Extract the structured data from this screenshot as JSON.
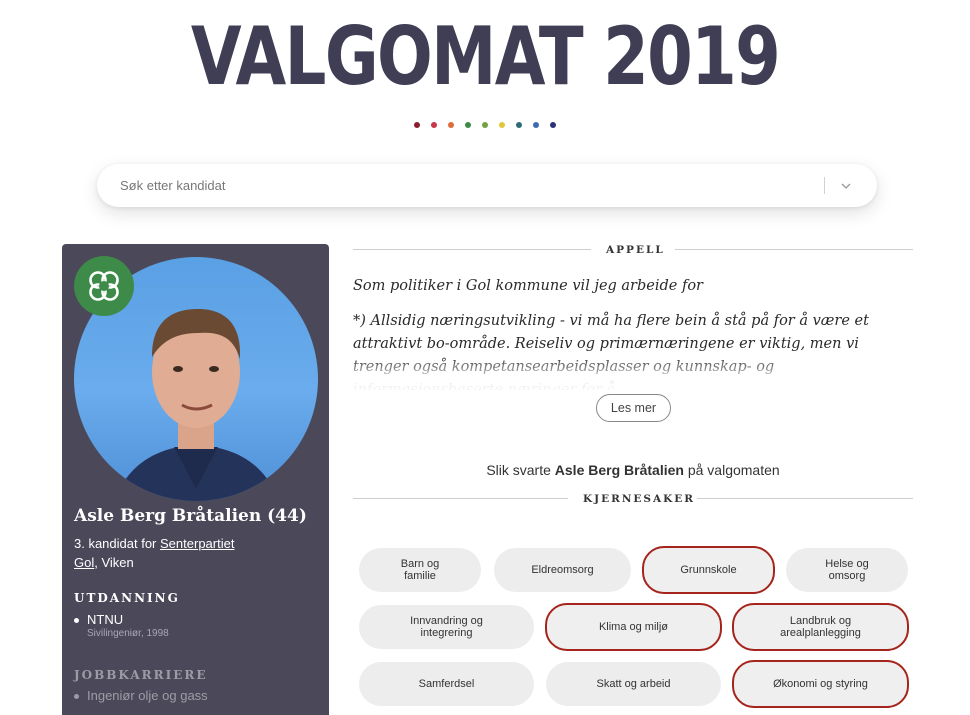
{
  "header": {
    "title": "VALGOMAT 2019",
    "dot_colors": [
      "#8b1e2e",
      "#c8374a",
      "#e06a3c",
      "#3d8a49",
      "#6fa33f",
      "#e2c73a",
      "#2e6b78",
      "#3b6bb4",
      "#2b3275"
    ]
  },
  "search": {
    "placeholder": "Søk etter kandidat",
    "value": ""
  },
  "candidate": {
    "name": "Asle Berg Bråtalien (44)",
    "rank_text": "3. kandidat for",
    "party": "Senterpartiet",
    "municipality": "Gol",
    "county": ", Viken",
    "party_logo": "clover-icon",
    "education_heading": "UTDANNING",
    "education": [
      {
        "school": "NTNU",
        "detail": "Sivilingeniør, 1998"
      }
    ],
    "career_heading": "JOBBKARRIERE",
    "career": [
      "Ingeniør olje og gass"
    ]
  },
  "appeal": {
    "heading": "APPELL",
    "para1": "Som politiker i Gol kommune vil jeg arbeide for",
    "para2": "*) Allsidig næringsutvikling - vi må ha flere bein å stå på for å være et attraktivt bo-område. Reiseliv og primærnæringene er viktig, men vi trenger også kompetansearbeidsplasser og kunnskap- og informasjonsbaserte næringer for å",
    "read_more": "Les mer"
  },
  "answered": {
    "prefix": "Slik svarte",
    "name": "Asle Berg Bråtalien",
    "suffix": "på valgomaten"
  },
  "core_issues": {
    "heading": "KJERNESAKER",
    "topics": [
      {
        "label": "Barn og familie",
        "core": false
      },
      {
        "label": "Eldreomsorg",
        "core": false
      },
      {
        "label": "Grunnskole",
        "core": true
      },
      {
        "label": "Helse og omsorg",
        "core": false
      },
      {
        "label": "Innvandring og integrering",
        "core": false
      },
      {
        "label": "Klima og miljø",
        "core": true
      },
      {
        "label": "Landbruk og arealplanlegging",
        "core": true
      },
      {
        "label": "Samferdsel",
        "core": false
      },
      {
        "label": "Skatt og arbeid",
        "core": false
      },
      {
        "label": "Økonomi og styring",
        "core": true
      }
    ],
    "core_border_color": "#a5241b"
  }
}
